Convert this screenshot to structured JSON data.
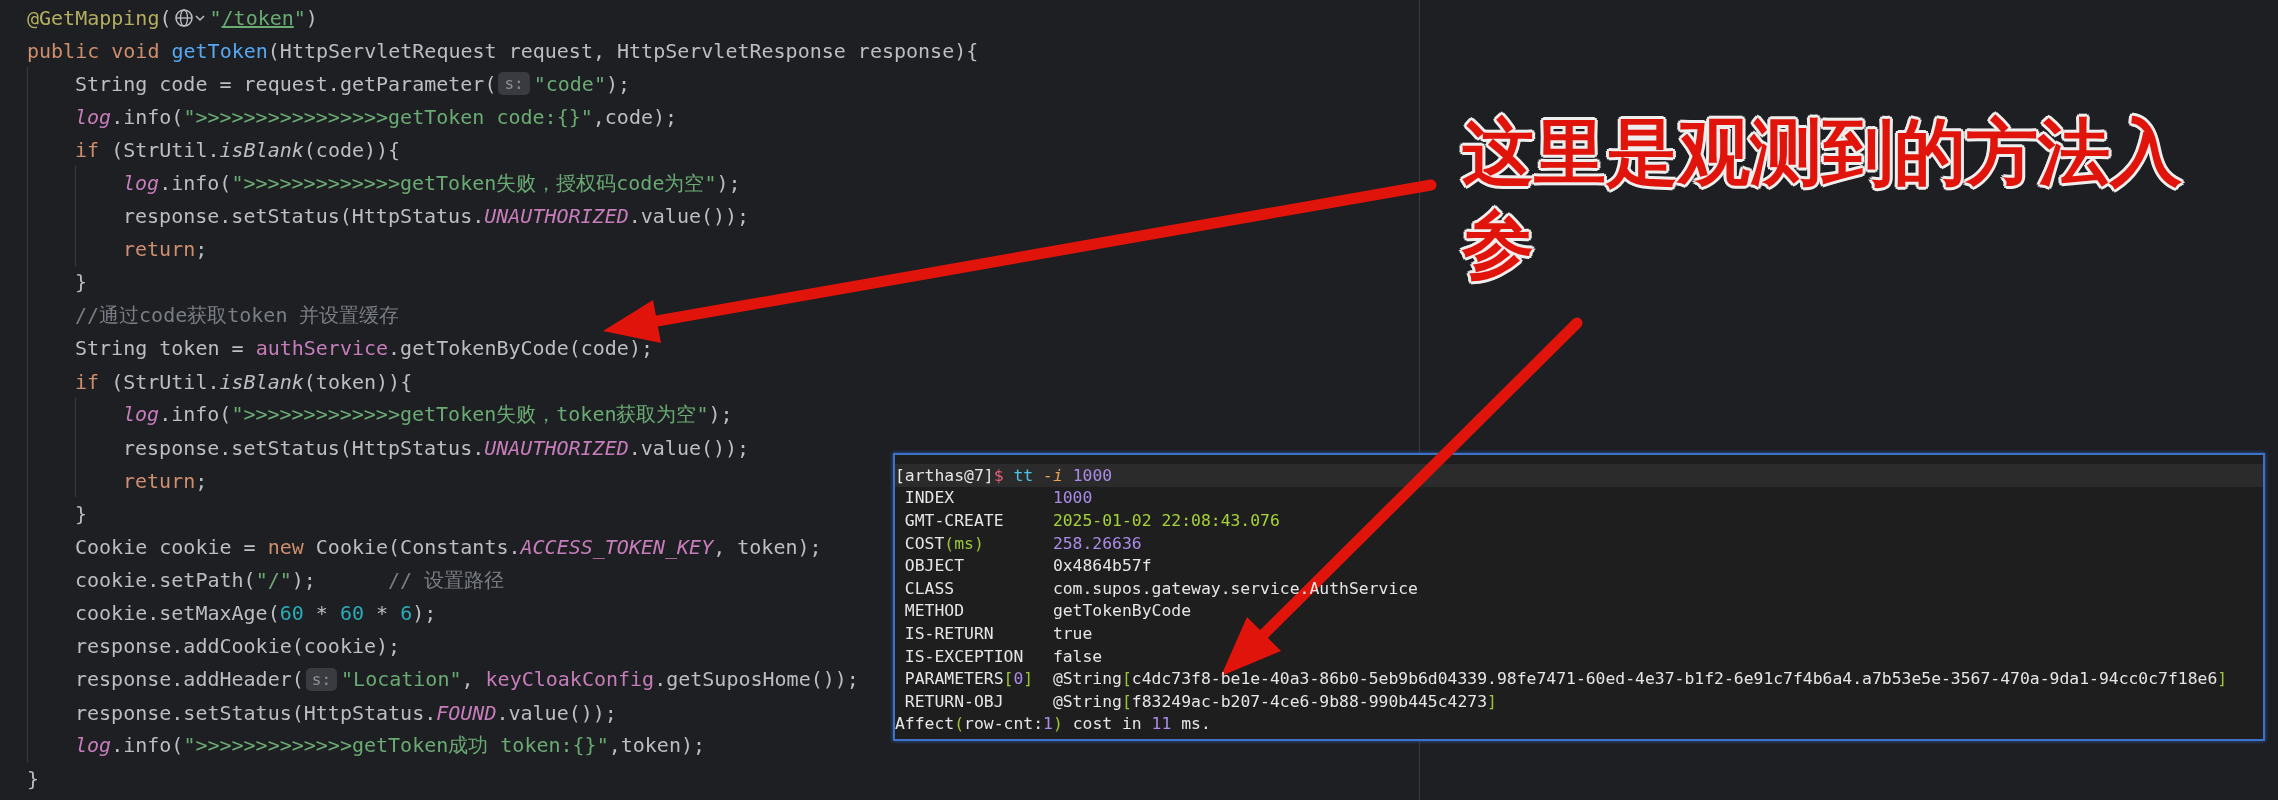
{
  "editor": {
    "lines": [
      {
        "segs": [
          {
            "text": "@GetMapping",
            "kind": "ann"
          },
          {
            "text": "(",
            "kind": "plain"
          },
          {
            "kind": "globe"
          },
          {
            "text": "\"",
            "kind": "str"
          },
          {
            "text": "/token",
            "kind": "link"
          },
          {
            "text": "\"",
            "kind": "str"
          },
          {
            "text": ")",
            "kind": "plain"
          }
        ]
      },
      {
        "segs": [
          {
            "text": "public void ",
            "kind": "kw"
          },
          {
            "text": "getToken",
            "kind": "fn"
          },
          {
            "text": "(HttpServletRequest request, HttpServletResponse response){",
            "kind": "plain"
          }
        ],
        "children": [
          {
            "segs": [
              {
                "text": "String code = request.getParameter(",
                "kind": "plain"
              },
              {
                "text": "s:",
                "kind": "hint"
              },
              {
                "text": "\"code\"",
                "kind": "str"
              },
              {
                "text": ");",
                "kind": "plain"
              }
            ]
          },
          {
            "segs": [
              {
                "text": "log",
                "kind": "field"
              },
              {
                "text": ".info(",
                "kind": "plain"
              },
              {
                "text": "\">>>>>>>>>>>>>>>>getToken code:{}\"",
                "kind": "str"
              },
              {
                "text": ",code);",
                "kind": "plain"
              }
            ]
          },
          {
            "segs": [
              {
                "text": "if ",
                "kind": "kw"
              },
              {
                "text": "(StrUtil.",
                "kind": "plain"
              },
              {
                "text": "isBlank",
                "kind": "static"
              },
              {
                "text": "(code)){",
                "kind": "plain"
              }
            ],
            "children": [
              {
                "segs": [
                  {
                    "text": "log",
                    "kind": "field"
                  },
                  {
                    "text": ".info(",
                    "kind": "plain"
                  },
                  {
                    "text": "\">>>>>>>>>>>>>getToken失败，授权码code为空\"",
                    "kind": "str"
                  },
                  {
                    "text": ");",
                    "kind": "plain"
                  }
                ]
              },
              {
                "segs": [
                  {
                    "text": "response.setStatus(HttpStatus.",
                    "kind": "plain"
                  },
                  {
                    "text": "UNAUTHORIZED",
                    "kind": "field"
                  },
                  {
                    "text": ".value());",
                    "kind": "plain"
                  }
                ]
              },
              {
                "segs": [
                  {
                    "text": "return",
                    "kind": "kw"
                  },
                  {
                    "text": ";",
                    "kind": "plain"
                  }
                ]
              }
            ]
          },
          {
            "segs": [
              {
                "text": "}",
                "kind": "plain"
              }
            ]
          },
          {
            "segs": [
              {
                "text": "//通过code获取token 并设置缓存",
                "kind": "comment"
              }
            ]
          },
          {
            "segs": [
              {
                "text": "String token = ",
                "kind": "plain"
              },
              {
                "text": "authService",
                "kind": "member"
              },
              {
                "text": ".getTokenByCode(code);",
                "kind": "plain"
              }
            ]
          },
          {
            "segs": [
              {
                "text": "if ",
                "kind": "kw"
              },
              {
                "text": "(StrUtil.",
                "kind": "plain"
              },
              {
                "text": "isBlank",
                "kind": "static"
              },
              {
                "text": "(token)){",
                "kind": "plain"
              }
            ],
            "children": [
              {
                "segs": [
                  {
                    "text": "log",
                    "kind": "field"
                  },
                  {
                    "text": ".info(",
                    "kind": "plain"
                  },
                  {
                    "text": "\">>>>>>>>>>>>>getToken失败，token获取为空\"",
                    "kind": "str"
                  },
                  {
                    "text": ");",
                    "kind": "plain"
                  }
                ]
              },
              {
                "segs": [
                  {
                    "text": "response.setStatus(HttpStatus.",
                    "kind": "plain"
                  },
                  {
                    "text": "UNAUTHORIZED",
                    "kind": "field"
                  },
                  {
                    "text": ".value());",
                    "kind": "plain"
                  }
                ]
              },
              {
                "segs": [
                  {
                    "text": "return",
                    "kind": "kw"
                  },
                  {
                    "text": ";",
                    "kind": "plain"
                  }
                ]
              }
            ]
          },
          {
            "segs": [
              {
                "text": "}",
                "kind": "plain"
              }
            ]
          },
          {
            "segs": [
              {
                "text": "Cookie cookie = ",
                "kind": "plain"
              },
              {
                "text": "new ",
                "kind": "kw"
              },
              {
                "text": "Cookie(Constants.",
                "kind": "plain"
              },
              {
                "text": "ACCESS_TOKEN_KEY",
                "kind": "field"
              },
              {
                "text": ", token);",
                "kind": "plain"
              }
            ]
          },
          {
            "segs": [
              {
                "text": "cookie.setPath(",
                "kind": "plain"
              },
              {
                "text": "\"/\"",
                "kind": "str"
              },
              {
                "text": ");      ",
                "kind": "plain"
              },
              {
                "text": "// 设置路径",
                "kind": "comment"
              }
            ]
          },
          {
            "segs": [
              {
                "text": "cookie.setMaxAge(",
                "kind": "plain"
              },
              {
                "text": "60",
                "kind": "num"
              },
              {
                "text": " * ",
                "kind": "plain"
              },
              {
                "text": "60",
                "kind": "num"
              },
              {
                "text": " * ",
                "kind": "plain"
              },
              {
                "text": "6",
                "kind": "num"
              },
              {
                "text": ");",
                "kind": "plain"
              }
            ]
          },
          {
            "segs": [
              {
                "text": "response.addCookie(cookie);",
                "kind": "plain"
              }
            ]
          },
          {
            "segs": [
              {
                "text": "response.addHeader(",
                "kind": "plain"
              },
              {
                "text": "s:",
                "kind": "hint"
              },
              {
                "text": "\"Location\"",
                "kind": "str"
              },
              {
                "text": ", ",
                "kind": "plain"
              },
              {
                "text": "keyCloakConfig",
                "kind": "member"
              },
              {
                "text": ".getSuposHome());",
                "kind": "plain"
              }
            ]
          },
          {
            "segs": [
              {
                "text": "response.setStatus(HttpStatus.",
                "kind": "plain"
              },
              {
                "text": "FOUND",
                "kind": "field"
              },
              {
                "text": ".value());",
                "kind": "plain"
              }
            ]
          },
          {
            "segs": [
              {
                "text": "log",
                "kind": "field"
              },
              {
                "text": ".info(",
                "kind": "plain"
              },
              {
                "text": "\">>>>>>>>>>>>>getToken成功 token:{}\"",
                "kind": "str"
              },
              {
                "text": ",token);",
                "kind": "plain"
              }
            ]
          }
        ]
      },
      {
        "segs": [
          {
            "text": "}",
            "kind": "plain"
          }
        ]
      }
    ]
  },
  "terminal": {
    "prompt": [
      {
        "text": "[arthas@7]",
        "kind": "plain"
      },
      {
        "text": "$",
        "kind": "prompt"
      },
      {
        "text": " tt",
        "kind": "cmd"
      },
      {
        "text": " -i",
        "kind": "flag"
      },
      {
        "text": " 1000",
        "kind": "num"
      }
    ],
    "rows": [
      {
        "label": [
          {
            "text": "INDEX",
            "kind": "plain"
          }
        ],
        "value": [
          {
            "text": "1000",
            "kind": "num"
          }
        ]
      },
      {
        "label": [
          {
            "text": "GMT-CREATE",
            "kind": "plain"
          }
        ],
        "value": [
          {
            "text": "2025-01-02 22:08:43.076",
            "kind": "date"
          }
        ]
      },
      {
        "label": [
          {
            "text": "COST",
            "kind": "plain"
          },
          {
            "text": "(ms)",
            "kind": "punct"
          }
        ],
        "value": [
          {
            "text": "258.26636",
            "kind": "num"
          }
        ]
      },
      {
        "label": [
          {
            "text": "OBJECT",
            "kind": "plain"
          }
        ],
        "value": [
          {
            "text": "0x4864b57f",
            "kind": "plain"
          }
        ]
      },
      {
        "label": [
          {
            "text": "CLASS",
            "kind": "plain"
          }
        ],
        "value": [
          {
            "text": "com.supos.gateway.service.AuthService",
            "kind": "plain"
          }
        ]
      },
      {
        "label": [
          {
            "text": "METHOD",
            "kind": "plain"
          }
        ],
        "value": [
          {
            "text": "getTokenByCode",
            "kind": "plain"
          }
        ]
      },
      {
        "label": [
          {
            "text": "IS-RETURN",
            "kind": "plain"
          }
        ],
        "value": [
          {
            "text": "true",
            "kind": "plain"
          }
        ]
      },
      {
        "label": [
          {
            "text": "IS-EXCEPTION",
            "kind": "plain"
          }
        ],
        "value": [
          {
            "text": "false",
            "kind": "plain"
          }
        ]
      },
      {
        "label": [
          {
            "text": "PARAMETERS",
            "kind": "plain"
          },
          {
            "text": "[",
            "kind": "punct"
          },
          {
            "text": "0",
            "kind": "num"
          },
          {
            "text": "]",
            "kind": "punct"
          }
        ],
        "value": [
          {
            "text": "@String",
            "kind": "plain"
          },
          {
            "text": "[",
            "kind": "punct"
          },
          {
            "text": "c4dc73f8-be1e-40a3-86b0-5eb9b6d04339.98fe7471-60ed-4e37-b1f2-6e91c7f4b6a4.a7b53e5e-3567-470a-9da1-94cc0c7f18e6",
            "kind": "plain"
          },
          {
            "text": "]",
            "kind": "punct"
          }
        ]
      },
      {
        "label": [
          {
            "text": "RETURN-OBJ",
            "kind": "plain"
          }
        ],
        "value": [
          {
            "text": "@String",
            "kind": "plain"
          },
          {
            "text": "[",
            "kind": "punct"
          },
          {
            "text": "f83249ac-b207-4ce6-9b88-990b445c4273",
            "kind": "plain"
          },
          {
            "text": "]",
            "kind": "punct"
          }
        ]
      }
    ],
    "footer": [
      {
        "text": "Affect",
        "kind": "plain"
      },
      {
        "text": "(",
        "kind": "punct"
      },
      {
        "text": "row-cnt:",
        "kind": "plain"
      },
      {
        "text": "1",
        "kind": "num"
      },
      {
        "text": ")",
        "kind": "punct"
      },
      {
        "text": " cost in ",
        "kind": "plain"
      },
      {
        "text": "11",
        "kind": "num"
      },
      {
        "text": " ms.",
        "kind": "plain"
      }
    ]
  },
  "annotation": {
    "text": "这里是观测到的方法入参"
  }
}
